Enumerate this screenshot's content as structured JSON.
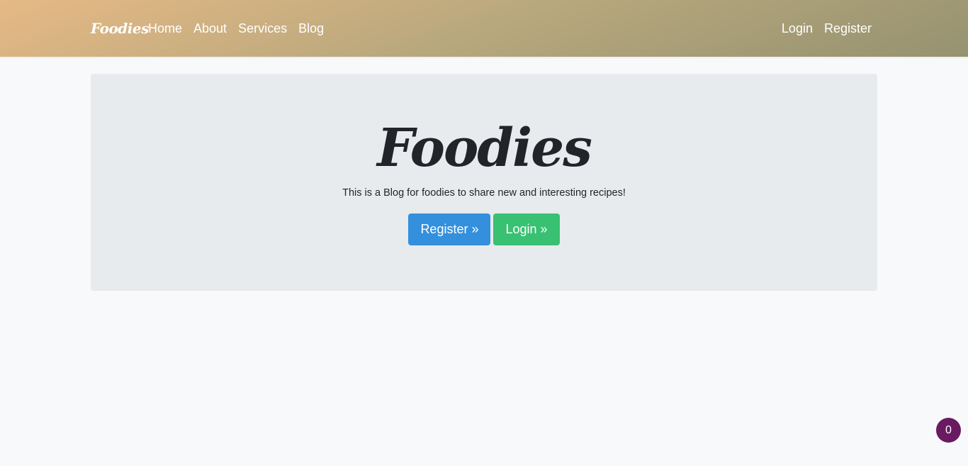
{
  "navbar": {
    "brand": "Foodies",
    "left_links": [
      "Home",
      "About",
      "Services",
      "Blog"
    ],
    "right_links": [
      "Login",
      "Register"
    ]
  },
  "hero": {
    "title": "Foodies",
    "subtitle": "This is a Blog for foodies to share new and interesting recipes!",
    "register_button": "Register »",
    "login_button": "Login »"
  },
  "floating_badge": {
    "count": "0"
  },
  "colors": {
    "navbar_gradient_start": "#e6b985",
    "navbar_gradient_end": "#969270",
    "jumbotron_bg": "#e8ebee",
    "register_button_bg": "#3490dc",
    "login_button_bg": "#38c172",
    "badge_bg": "#6a1a61",
    "page_bg": "#f8f9fb"
  }
}
